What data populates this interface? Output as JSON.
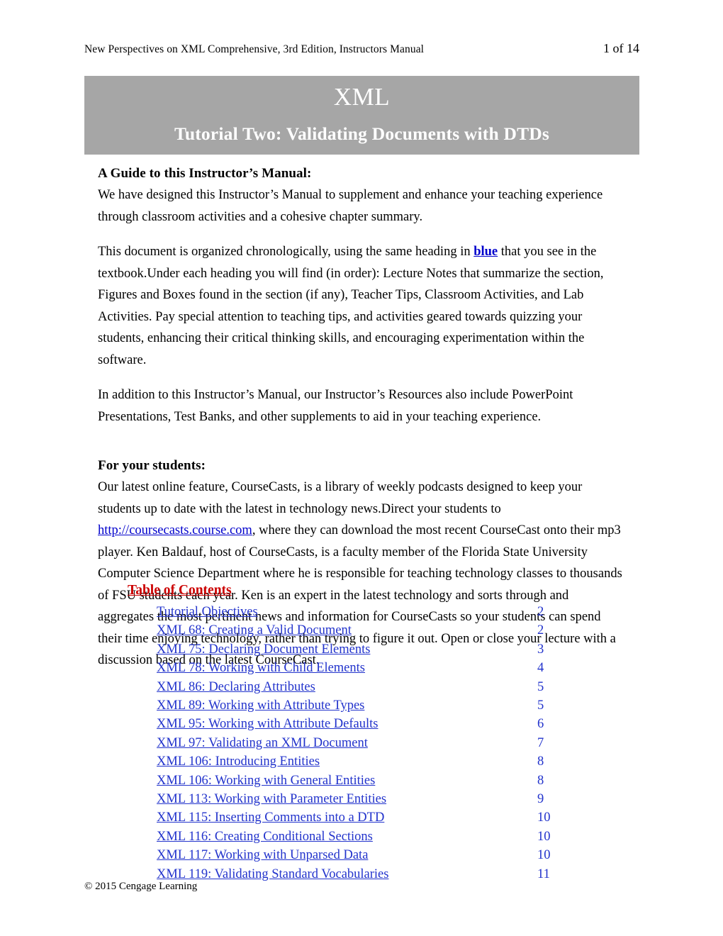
{
  "header": {
    "title": "New Perspectives on XML Comprehensive, 3rd Edition, Instructors Manual",
    "page_indicator": "1 of 14"
  },
  "banner": {
    "main_title": "XML",
    "subtitle": "Tutorial Two: Validating Documents with DTDs",
    "background_color": "#a6a6a6",
    "text_color": "#ffffff"
  },
  "sections": {
    "guide": {
      "heading": "A Guide to this Instructor’s Manual:",
      "paragraph_1": "We have designed this Instructor’s Manual to supplement and enhance your teaching experience through classroom activities and a cohesive chapter summary.",
      "paragraph_2_part_1": "This document is organized chronologically, using the same heading in ",
      "paragraph_2_highlight": "blue",
      "paragraph_2_part_2": " that you see in the textbook.Under each heading you will find (in order): Lecture Notes that summarize the section, Figures and Boxes found in the section (if any), Teacher Tips, Classroom Activities, and Lab Activities. Pay special attention to teaching tips, and activities geared towards quizzing your students, enhancing their critical thinking skills, and encouraging experimentation within the software.",
      "paragraph_3": "In addition to this Instructor’s Manual, our Instructor’s Resources also include PowerPoint Presentations, Test Banks, and other supplements to aid in your teaching experience."
    },
    "students": {
      "heading": "For your students:",
      "paragraph_part_1": "Our latest online feature, CourseCasts, is a library of weekly podcasts designed to keep your students up to date with the latest in technology news.Direct your students to ",
      "link_text": "http://coursecasts.course.com",
      "paragraph_part_2": ", where they can download the most recent CourseCast onto their mp3 player. Ken Baldauf, host of CourseCasts, is a faculty member of the Florida State University Computer Science Department where he is responsible for teaching technology classes to thousands of FSU students each year. Ken is an expert in the latest technology and sorts through and aggregates the most pertinent news and information for CourseCasts so your students can spend their time enjoying technology, rather than trying to figure it out. Open or close your lecture with a discussion based on the latest CourseCast."
    }
  },
  "table_of_contents": {
    "title": "Table of Contents ",
    "link_color": "#2233cc",
    "entries": [
      {
        "label": "Tutorial Objectives ",
        "page": "2"
      },
      {
        "label": "XML 68: Creating a Valid Document",
        "page": "2"
      },
      {
        "label": "XML 75: Declaring Document Elements",
        "page": "3"
      },
      {
        "label": "XML 78: Working with Child Elements",
        "page": "4"
      },
      {
        "label": "XML 86: Declaring Attributes",
        "page": "5"
      },
      {
        "label": "XML 89: Working with Attribute Types",
        "page": "5"
      },
      {
        "label": "XML 95: Working with Attribute Defaults",
        "page": "6"
      },
      {
        "label": "XML 97: Validating an XML Document",
        "page": "7"
      },
      {
        "label": "XML 106: Introducing Entities",
        "page": "8"
      },
      {
        "label": "XML 106: Working with General Entities",
        "page": "8"
      },
      {
        "label": "XML 113: Working with Parameter Entities",
        "page": "9"
      },
      {
        "label": "XML 115: Inserting Comments into a DTD",
        "page": "10"
      },
      {
        "label": "XML 116: Creating Conditional Sections",
        "page": "10"
      },
      {
        "label": "XML 117: Working with Unparsed Data",
        "page": "10"
      },
      {
        "label": "XML 119: Validating Standard Vocabularies",
        "page": "11"
      }
    ]
  },
  "footer": {
    "copyright": "© 2015 Cengage Learning"
  }
}
